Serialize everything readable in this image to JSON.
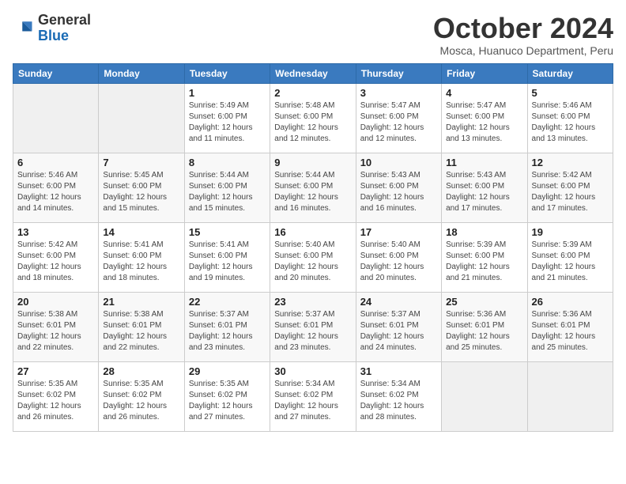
{
  "logo": {
    "text_general": "General",
    "text_blue": "Blue"
  },
  "header": {
    "month": "October 2024",
    "location": "Mosca, Huanuco Department, Peru"
  },
  "weekdays": [
    "Sunday",
    "Monday",
    "Tuesday",
    "Wednesday",
    "Thursday",
    "Friday",
    "Saturday"
  ],
  "weeks": [
    [
      {
        "day": "",
        "info": ""
      },
      {
        "day": "",
        "info": ""
      },
      {
        "day": "1",
        "info": "Sunrise: 5:49 AM\nSunset: 6:00 PM\nDaylight: 12 hours and 11 minutes."
      },
      {
        "day": "2",
        "info": "Sunrise: 5:48 AM\nSunset: 6:00 PM\nDaylight: 12 hours and 12 minutes."
      },
      {
        "day": "3",
        "info": "Sunrise: 5:47 AM\nSunset: 6:00 PM\nDaylight: 12 hours and 12 minutes."
      },
      {
        "day": "4",
        "info": "Sunrise: 5:47 AM\nSunset: 6:00 PM\nDaylight: 12 hours and 13 minutes."
      },
      {
        "day": "5",
        "info": "Sunrise: 5:46 AM\nSunset: 6:00 PM\nDaylight: 12 hours and 13 minutes."
      }
    ],
    [
      {
        "day": "6",
        "info": "Sunrise: 5:46 AM\nSunset: 6:00 PM\nDaylight: 12 hours and 14 minutes."
      },
      {
        "day": "7",
        "info": "Sunrise: 5:45 AM\nSunset: 6:00 PM\nDaylight: 12 hours and 15 minutes."
      },
      {
        "day": "8",
        "info": "Sunrise: 5:44 AM\nSunset: 6:00 PM\nDaylight: 12 hours and 15 minutes."
      },
      {
        "day": "9",
        "info": "Sunrise: 5:44 AM\nSunset: 6:00 PM\nDaylight: 12 hours and 16 minutes."
      },
      {
        "day": "10",
        "info": "Sunrise: 5:43 AM\nSunset: 6:00 PM\nDaylight: 12 hours and 16 minutes."
      },
      {
        "day": "11",
        "info": "Sunrise: 5:43 AM\nSunset: 6:00 PM\nDaylight: 12 hours and 17 minutes."
      },
      {
        "day": "12",
        "info": "Sunrise: 5:42 AM\nSunset: 6:00 PM\nDaylight: 12 hours and 17 minutes."
      }
    ],
    [
      {
        "day": "13",
        "info": "Sunrise: 5:42 AM\nSunset: 6:00 PM\nDaylight: 12 hours and 18 minutes."
      },
      {
        "day": "14",
        "info": "Sunrise: 5:41 AM\nSunset: 6:00 PM\nDaylight: 12 hours and 18 minutes."
      },
      {
        "day": "15",
        "info": "Sunrise: 5:41 AM\nSunset: 6:00 PM\nDaylight: 12 hours and 19 minutes."
      },
      {
        "day": "16",
        "info": "Sunrise: 5:40 AM\nSunset: 6:00 PM\nDaylight: 12 hours and 20 minutes."
      },
      {
        "day": "17",
        "info": "Sunrise: 5:40 AM\nSunset: 6:00 PM\nDaylight: 12 hours and 20 minutes."
      },
      {
        "day": "18",
        "info": "Sunrise: 5:39 AM\nSunset: 6:00 PM\nDaylight: 12 hours and 21 minutes."
      },
      {
        "day": "19",
        "info": "Sunrise: 5:39 AM\nSunset: 6:00 PM\nDaylight: 12 hours and 21 minutes."
      }
    ],
    [
      {
        "day": "20",
        "info": "Sunrise: 5:38 AM\nSunset: 6:01 PM\nDaylight: 12 hours and 22 minutes."
      },
      {
        "day": "21",
        "info": "Sunrise: 5:38 AM\nSunset: 6:01 PM\nDaylight: 12 hours and 22 minutes."
      },
      {
        "day": "22",
        "info": "Sunrise: 5:37 AM\nSunset: 6:01 PM\nDaylight: 12 hours and 23 minutes."
      },
      {
        "day": "23",
        "info": "Sunrise: 5:37 AM\nSunset: 6:01 PM\nDaylight: 12 hours and 23 minutes."
      },
      {
        "day": "24",
        "info": "Sunrise: 5:37 AM\nSunset: 6:01 PM\nDaylight: 12 hours and 24 minutes."
      },
      {
        "day": "25",
        "info": "Sunrise: 5:36 AM\nSunset: 6:01 PM\nDaylight: 12 hours and 25 minutes."
      },
      {
        "day": "26",
        "info": "Sunrise: 5:36 AM\nSunset: 6:01 PM\nDaylight: 12 hours and 25 minutes."
      }
    ],
    [
      {
        "day": "27",
        "info": "Sunrise: 5:35 AM\nSunset: 6:02 PM\nDaylight: 12 hours and 26 minutes."
      },
      {
        "day": "28",
        "info": "Sunrise: 5:35 AM\nSunset: 6:02 PM\nDaylight: 12 hours and 26 minutes."
      },
      {
        "day": "29",
        "info": "Sunrise: 5:35 AM\nSunset: 6:02 PM\nDaylight: 12 hours and 27 minutes."
      },
      {
        "day": "30",
        "info": "Sunrise: 5:34 AM\nSunset: 6:02 PM\nDaylight: 12 hours and 27 minutes."
      },
      {
        "day": "31",
        "info": "Sunrise: 5:34 AM\nSunset: 6:02 PM\nDaylight: 12 hours and 28 minutes."
      },
      {
        "day": "",
        "info": ""
      },
      {
        "day": "",
        "info": ""
      }
    ]
  ]
}
